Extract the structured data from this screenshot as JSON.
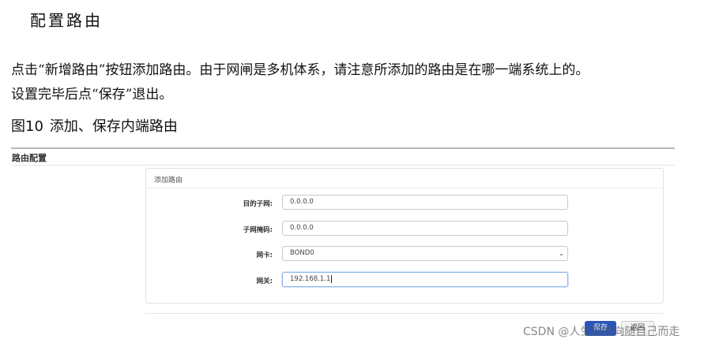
{
  "document": {
    "heading": "配置路由",
    "paragraph": [
      "点击“新增路由”按钮添加路由。由于网闸是多机体系，请注意所添加的路由是在哪一端系统上的。",
      "设置完毕后点“保存”退出。"
    ],
    "figure": {
      "number": "图10",
      "title": "添加、保存内端路由"
    }
  },
  "screenshot": {
    "panel_title": "路由配置",
    "box_title": "添加路由",
    "fields": [
      {
        "label": "目的子网:",
        "value": "0.0.0.0"
      },
      {
        "label": "子网掩码:",
        "value": "0.0.0.0"
      },
      {
        "label": "网卡:",
        "value": "BOND0"
      },
      {
        "label": "网关:",
        "value": "192.168.1.1"
      }
    ],
    "save_label": "保存",
    "return_label": "返回"
  },
  "watermark": "CSDN @人生的方向随自己而走"
}
